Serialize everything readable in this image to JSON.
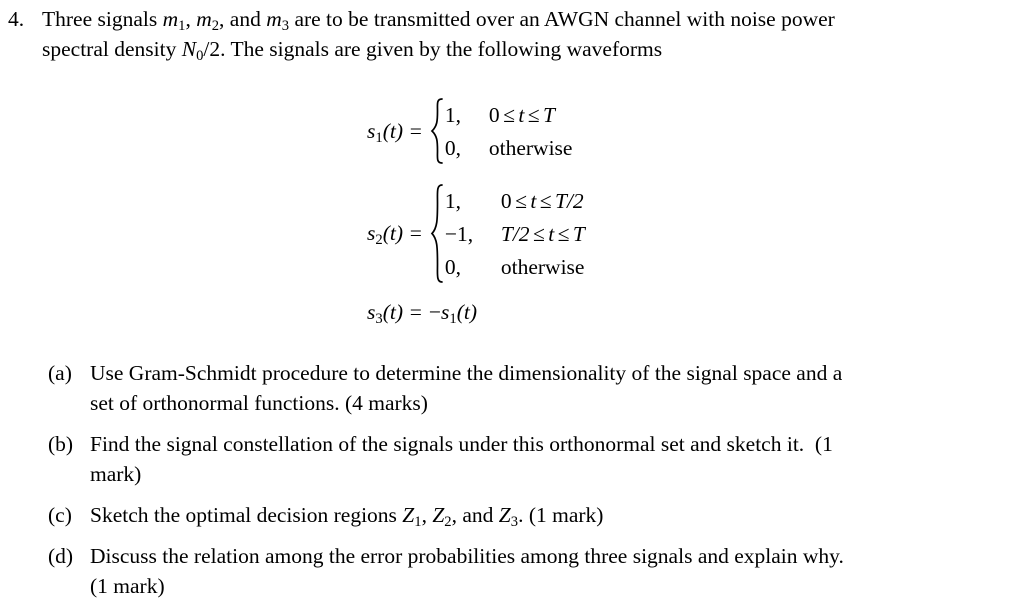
{
  "document": {
    "type": "exam-question",
    "background_color": "#ffffff",
    "text_color": "#000000"
  },
  "question": {
    "number": "4.",
    "line1": "Three signals m1, m2, and m3 are to be transmitted over an AWGN channel with noise power",
    "line2": "spectral density N0/2. The signals are given by the following waveforms",
    "line1_parts": {
      "before_m1": "Three signals ",
      "m_base": "m",
      "m1_sub": "1",
      "sep1": ", ",
      "m2_sub": "2",
      "sep2": ", and ",
      "m3_sub": "3",
      "after_m3": " are to be transmitted over an AWGN channel with noise power"
    },
    "line2_parts": {
      "before_N": "spectral density ",
      "N_base": "N",
      "N_sub": "0",
      "after_N": "/2. The signals are given by the following waveforms"
    }
  },
  "equations": [
    {
      "id": "s1",
      "lhs_base": "s",
      "lhs_sub": "1",
      "lhs_arg": "(t) =",
      "cases": [
        {
          "value": "1,",
          "condition_parts": {
            "a": "0",
            "rel1": "≤",
            "var": "t",
            "rel2": "≤",
            "b": "T"
          },
          "condition": "0 ≤ t ≤ T"
        },
        {
          "value": "0,",
          "condition": "otherwise",
          "is_text": true
        }
      ]
    },
    {
      "id": "s2",
      "lhs_base": "s",
      "lhs_sub": "2",
      "lhs_arg": "(t) =",
      "cases": [
        {
          "value": "1,",
          "condition_parts": {
            "a": "0",
            "rel1": "≤",
            "var": "t",
            "rel2": "≤",
            "b": "T/2"
          },
          "condition": "0 ≤ t ≤ T/2"
        },
        {
          "value": "−1,",
          "condition_parts": {
            "a": "T/2",
            "rel1": "≤",
            "var": "t",
            "rel2": "≤",
            "b": "T"
          },
          "condition": "T/2 ≤ t ≤ T"
        },
        {
          "value": "0,",
          "condition": "otherwise",
          "is_text": true
        }
      ]
    },
    {
      "id": "s3",
      "lhs_base": "s",
      "lhs_sub": "3",
      "lhs_arg": "(t) =",
      "rhs_sign": "−",
      "rhs_base": "s",
      "rhs_sub": "1",
      "rhs_arg": "(t)",
      "full": "s3(t) = −s1(t)"
    }
  ],
  "subquestions": [
    {
      "marker": "(a)",
      "line1": "Use Gram-Schmidt procedure to determine the dimensionality of the signal space and a",
      "line2": "set of orthonormal functions. (4 marks)",
      "marks": "(4 marks)"
    },
    {
      "marker": "(b)",
      "line1_a": "Find the signal constellation of the signals under this orthonormal set and sketch it.",
      "line1_b": "(1",
      "line2": "mark)",
      "marks": "(1 mark)"
    },
    {
      "marker": "(c)",
      "line1_before": "Sketch the optimal decision regions ",
      "z_base": "Z",
      "z1_sub": "1",
      "z_sep1": ", ",
      "z2_sub": "2",
      "z_sep2": ", and ",
      "z3_sub": "3",
      "line1_after": ". (1 mark)",
      "marks": "(1 mark)"
    },
    {
      "marker": "(d)",
      "line1": "Discuss the relation among the error probabilities among three signals and explain why.",
      "line2": "(1 mark)",
      "marks": "(1 mark)"
    }
  ]
}
